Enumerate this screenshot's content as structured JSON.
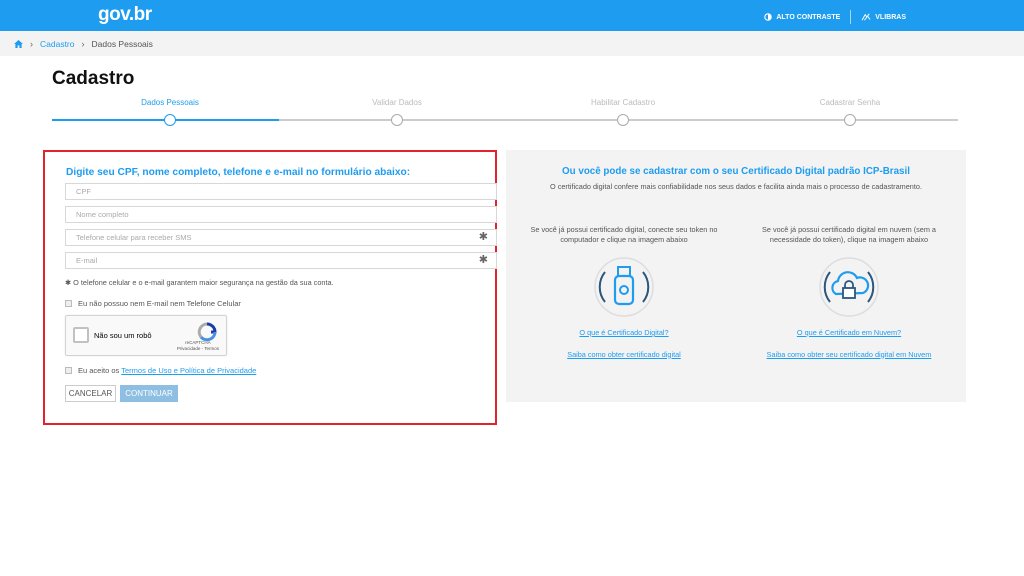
{
  "header": {
    "logo": "gov.br",
    "contrast": "ALTO CONTRASTE",
    "vlibras": "VLIBRAS"
  },
  "breadcrumb": {
    "items": [
      "Cadastro",
      "Dados Pessoais"
    ]
  },
  "page": {
    "title": "Cadastro"
  },
  "steps": [
    {
      "label": "Dados Pessoais",
      "active": true
    },
    {
      "label": "Validar Dados",
      "active": false
    },
    {
      "label": "Habilitar Cadastro",
      "active": false
    },
    {
      "label": "Cadastrar Senha",
      "active": false
    }
  ],
  "form": {
    "title": "Digite seu CPF, nome completo, telefone e e-mail no formulário abaixo:",
    "cpf_placeholder": "CPF",
    "name_placeholder": "Nome completo",
    "phone_placeholder": "Telefone celular para receber SMS",
    "email_placeholder": "E-mail",
    "required_mark": "✱",
    "note": "O telefone celular e o e-mail garantem maior segurança na gestão da sua conta.",
    "no_contact_label": "Eu não possuo nem E-mail nem Telefone Celular",
    "captcha_label": "Não sou um robô",
    "captcha_brand": "reCAPTCHA",
    "captcha_links": "Privacidade - Termos",
    "accept_prefix": "Eu aceito os ",
    "accept_link": "Termos de Uso e Política de Privacidade",
    "cancel_label": "CANCELAR",
    "continue_label": "CONTINUAR"
  },
  "certificate": {
    "title": "Ou você pode se cadastrar com o seu Certificado Digital padrão ICP-Brasil",
    "subtitle": "O certificado digital confere mais confiabilidade nos seus dados e facilita ainda mais o processo de cadastramento.",
    "left_text": "Se você já possui certificado digital, conecte seu token no computador e clique na imagem abaixo",
    "left_link1": "O que é Certificado Digital?",
    "left_link2": "Saiba como obter certificado digital",
    "right_text": "Se você já possui certificado digital em nuvem (sem a necessidade do token), clique na imagem abaixo",
    "right_link1": "O que é Certificado em Nuvem?",
    "right_link2": "Saiba como obter seu certificado digital em Nuvem"
  },
  "colors": {
    "brand": "#1e9cf0",
    "highlight_border": "#e0232c"
  }
}
